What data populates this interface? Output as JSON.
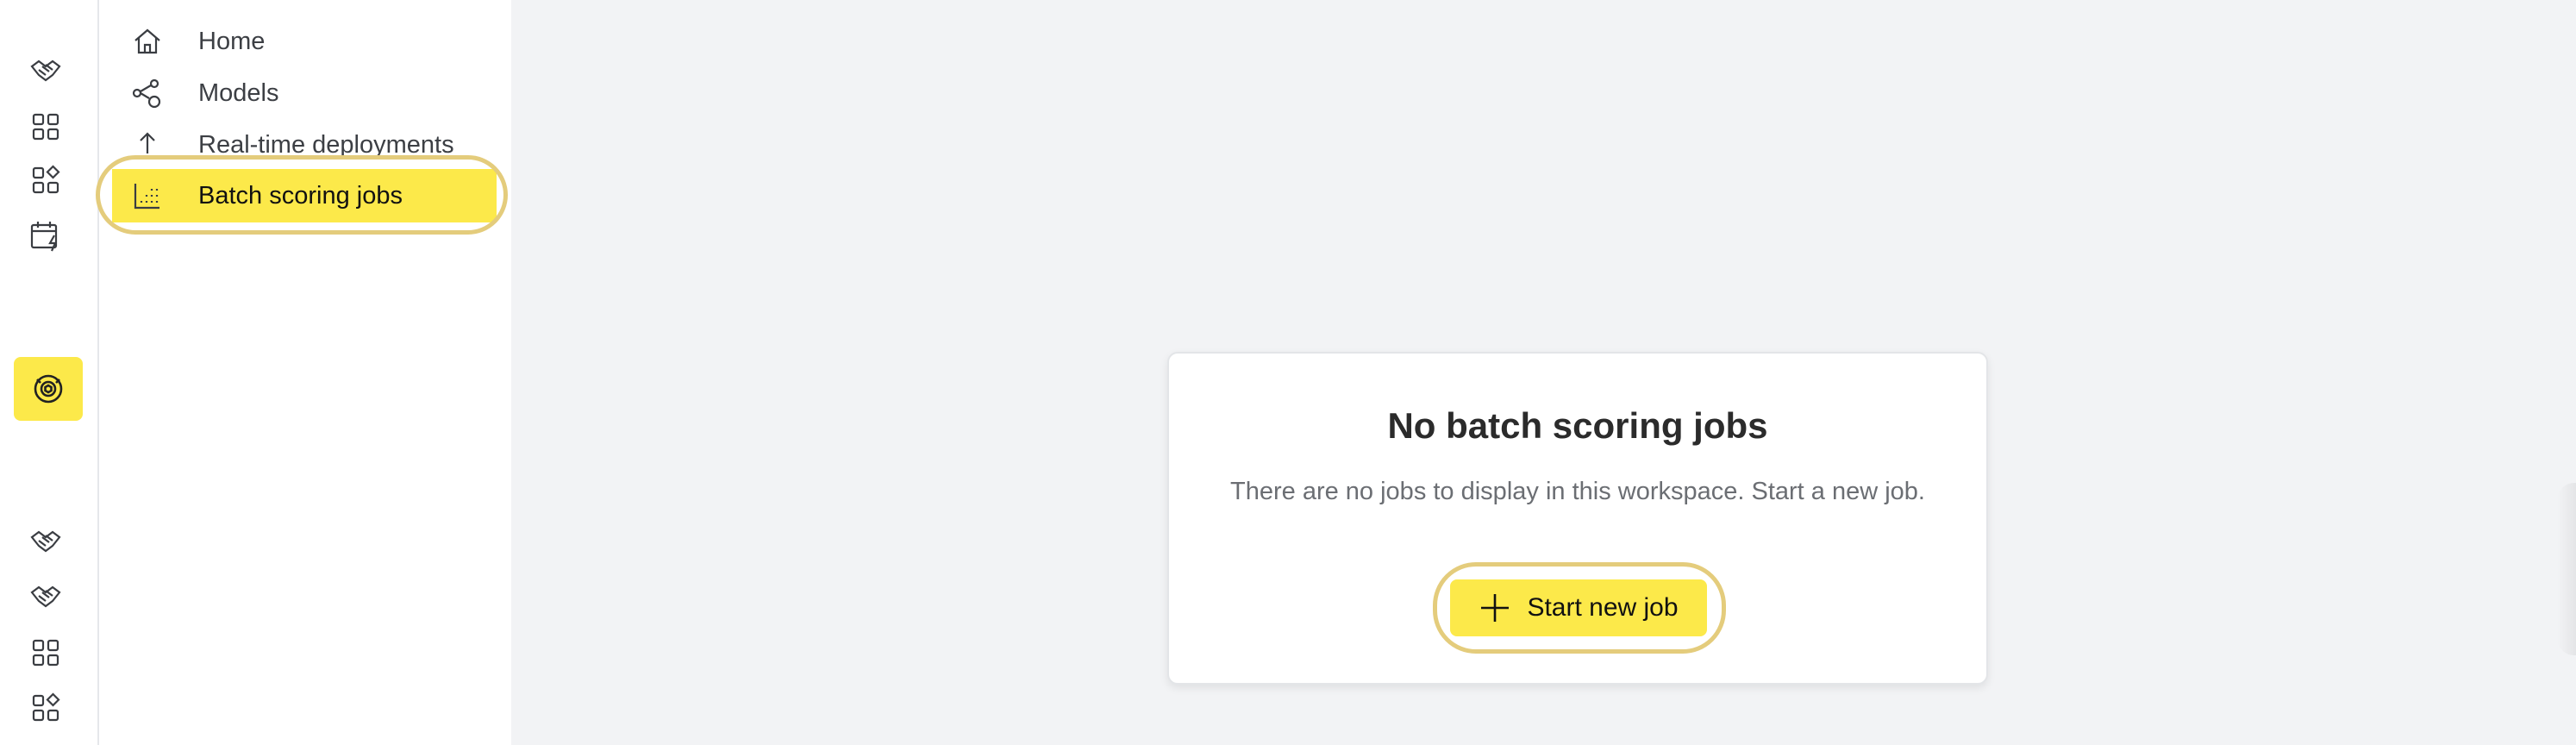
{
  "rail": {
    "icons": [
      "handshake-icon",
      "grid-icon",
      "grid-shapes-icon",
      "calendar-bolt-icon",
      "model-target-icon",
      "handshake-icon",
      "handshake-icon",
      "grid-icon",
      "grid-shapes-icon"
    ],
    "active": "model-target-icon"
  },
  "nav": {
    "items": [
      {
        "label": "Home",
        "icon": "home-icon"
      },
      {
        "label": "Models",
        "icon": "models-icon"
      },
      {
        "label": "Real-time deployments",
        "icon": "upload-icon"
      },
      {
        "label": "Batch scoring jobs",
        "icon": "batch-chart-icon",
        "active": true
      }
    ]
  },
  "empty_state": {
    "title": "No batch scoring jobs",
    "description": "There are no jobs to display in this workspace. Start a new job.",
    "button_label": "Start new job",
    "button_icon": "plus-icon"
  },
  "colors": {
    "accent": "#fce94a",
    "highlight_ring": "#e4cc7c",
    "background": "#f2f3f5"
  }
}
